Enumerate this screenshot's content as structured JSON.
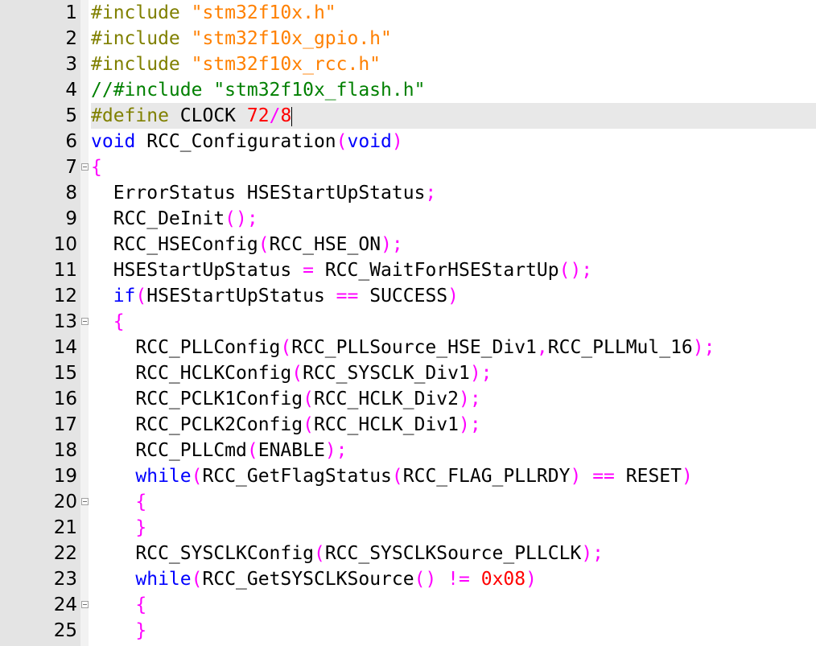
{
  "editor": {
    "current_line": 5,
    "colors": {
      "preprocessor": "#808000",
      "string": "#ff8000",
      "comment": "#008000",
      "keyword": "#0000ff",
      "number": "#ff0000",
      "operator": "#ff00ff",
      "identifier": "#000000"
    },
    "lines": [
      {
        "number": "1",
        "fold": false,
        "tokens": [
          {
            "t": "preproc",
            "v": "#include "
          },
          {
            "t": "string",
            "v": "\"stm32f10x.h\""
          }
        ]
      },
      {
        "number": "2",
        "fold": false,
        "tokens": [
          {
            "t": "preproc",
            "v": "#include "
          },
          {
            "t": "string",
            "v": "\"stm32f10x_gpio.h\""
          }
        ]
      },
      {
        "number": "3",
        "fold": false,
        "tokens": [
          {
            "t": "preproc",
            "v": "#include "
          },
          {
            "t": "string",
            "v": "\"stm32f10x_rcc.h\""
          }
        ]
      },
      {
        "number": "4",
        "fold": false,
        "tokens": [
          {
            "t": "comment",
            "v": "//#include \"stm32f10x_flash.h\""
          }
        ]
      },
      {
        "number": "5",
        "fold": false,
        "tokens": [
          {
            "t": "preproc",
            "v": "#define "
          },
          {
            "t": "plain",
            "v": "CLOCK "
          },
          {
            "t": "number",
            "v": "72"
          },
          {
            "t": "op",
            "v": "/"
          },
          {
            "t": "number",
            "v": "8"
          }
        ]
      },
      {
        "number": "6",
        "fold": false,
        "tokens": [
          {
            "t": "keyword",
            "v": "void"
          },
          {
            "t": "plain",
            "v": " RCC_Configuration"
          },
          {
            "t": "op",
            "v": "("
          },
          {
            "t": "keyword",
            "v": "void"
          },
          {
            "t": "op",
            "v": ")"
          }
        ]
      },
      {
        "number": "7",
        "fold": true,
        "tokens": [
          {
            "t": "op",
            "v": "{"
          }
        ]
      },
      {
        "number": "8",
        "fold": false,
        "tokens": [
          {
            "t": "plain",
            "v": "  ErrorStatus HSEStartUpStatus"
          },
          {
            "t": "op",
            "v": ";"
          }
        ]
      },
      {
        "number": "9",
        "fold": false,
        "tokens": [
          {
            "t": "plain",
            "v": "  RCC_DeInit"
          },
          {
            "t": "op",
            "v": "();"
          }
        ]
      },
      {
        "number": "10",
        "fold": false,
        "tokens": [
          {
            "t": "plain",
            "v": "  RCC_HSEConfig"
          },
          {
            "t": "op",
            "v": "("
          },
          {
            "t": "plain",
            "v": "RCC_HSE_ON"
          },
          {
            "t": "op",
            "v": ");"
          }
        ]
      },
      {
        "number": "11",
        "fold": false,
        "tokens": [
          {
            "t": "plain",
            "v": "  HSEStartUpStatus "
          },
          {
            "t": "op",
            "v": "="
          },
          {
            "t": "plain",
            "v": " RCC_WaitForHSEStartUp"
          },
          {
            "t": "op",
            "v": "();"
          }
        ]
      },
      {
        "number": "12",
        "fold": false,
        "tokens": [
          {
            "t": "plain",
            "v": "  "
          },
          {
            "t": "keyword",
            "v": "if"
          },
          {
            "t": "op",
            "v": "("
          },
          {
            "t": "plain",
            "v": "HSEStartUpStatus "
          },
          {
            "t": "op",
            "v": "=="
          },
          {
            "t": "plain",
            "v": " SUCCESS"
          },
          {
            "t": "op",
            "v": ")"
          }
        ]
      },
      {
        "number": "13",
        "fold": true,
        "tokens": [
          {
            "t": "plain",
            "v": "  "
          },
          {
            "t": "op",
            "v": "{"
          }
        ]
      },
      {
        "number": "14",
        "fold": false,
        "tokens": [
          {
            "t": "plain",
            "v": "    RCC_PLLConfig"
          },
          {
            "t": "op",
            "v": "("
          },
          {
            "t": "plain",
            "v": "RCC_PLLSource_HSE_Div1"
          },
          {
            "t": "op",
            "v": ","
          },
          {
            "t": "plain",
            "v": "RCC_PLLMul_16"
          },
          {
            "t": "op",
            "v": ");"
          }
        ]
      },
      {
        "number": "15",
        "fold": false,
        "tokens": [
          {
            "t": "plain",
            "v": "    RCC_HCLKConfig"
          },
          {
            "t": "op",
            "v": "("
          },
          {
            "t": "plain",
            "v": "RCC_SYSCLK_Div1"
          },
          {
            "t": "op",
            "v": ");"
          }
        ]
      },
      {
        "number": "16",
        "fold": false,
        "tokens": [
          {
            "t": "plain",
            "v": "    RCC_PCLK1Config"
          },
          {
            "t": "op",
            "v": "("
          },
          {
            "t": "plain",
            "v": "RCC_HCLK_Div2"
          },
          {
            "t": "op",
            "v": ");"
          }
        ]
      },
      {
        "number": "17",
        "fold": false,
        "tokens": [
          {
            "t": "plain",
            "v": "    RCC_PCLK2Config"
          },
          {
            "t": "op",
            "v": "("
          },
          {
            "t": "plain",
            "v": "RCC_HCLK_Div1"
          },
          {
            "t": "op",
            "v": ");"
          }
        ]
      },
      {
        "number": "18",
        "fold": false,
        "tokens": [
          {
            "t": "plain",
            "v": "    RCC_PLLCmd"
          },
          {
            "t": "op",
            "v": "("
          },
          {
            "t": "plain",
            "v": "ENABLE"
          },
          {
            "t": "op",
            "v": ");"
          }
        ]
      },
      {
        "number": "19",
        "fold": false,
        "tokens": [
          {
            "t": "plain",
            "v": "    "
          },
          {
            "t": "keyword",
            "v": "while"
          },
          {
            "t": "op",
            "v": "("
          },
          {
            "t": "plain",
            "v": "RCC_GetFlagStatus"
          },
          {
            "t": "op",
            "v": "("
          },
          {
            "t": "plain",
            "v": "RCC_FLAG_PLLRDY"
          },
          {
            "t": "op",
            "v": ")"
          },
          {
            "t": "plain",
            "v": " "
          },
          {
            "t": "op",
            "v": "=="
          },
          {
            "t": "plain",
            "v": " RESET"
          },
          {
            "t": "op",
            "v": ")"
          }
        ]
      },
      {
        "number": "20",
        "fold": true,
        "tokens": [
          {
            "t": "plain",
            "v": "    "
          },
          {
            "t": "op",
            "v": "{"
          }
        ]
      },
      {
        "number": "21",
        "fold": false,
        "tokens": [
          {
            "t": "plain",
            "v": "    "
          },
          {
            "t": "op",
            "v": "}"
          }
        ]
      },
      {
        "number": "22",
        "fold": false,
        "tokens": [
          {
            "t": "plain",
            "v": "    RCC_SYSCLKConfig"
          },
          {
            "t": "op",
            "v": "("
          },
          {
            "t": "plain",
            "v": "RCC_SYSCLKSource_PLLCLK"
          },
          {
            "t": "op",
            "v": ");"
          }
        ]
      },
      {
        "number": "23",
        "fold": false,
        "tokens": [
          {
            "t": "plain",
            "v": "    "
          },
          {
            "t": "keyword",
            "v": "while"
          },
          {
            "t": "op",
            "v": "("
          },
          {
            "t": "plain",
            "v": "RCC_GetSYSCLKSource"
          },
          {
            "t": "op",
            "v": "()"
          },
          {
            "t": "plain",
            "v": " "
          },
          {
            "t": "op",
            "v": "!="
          },
          {
            "t": "plain",
            "v": " "
          },
          {
            "t": "number",
            "v": "0x08"
          },
          {
            "t": "op",
            "v": ")"
          }
        ]
      },
      {
        "number": "24",
        "fold": true,
        "tokens": [
          {
            "t": "plain",
            "v": "    "
          },
          {
            "t": "op",
            "v": "{"
          }
        ]
      },
      {
        "number": "25",
        "fold": false,
        "tokens": [
          {
            "t": "plain",
            "v": "    "
          },
          {
            "t": "op",
            "v": "}"
          }
        ]
      }
    ]
  }
}
